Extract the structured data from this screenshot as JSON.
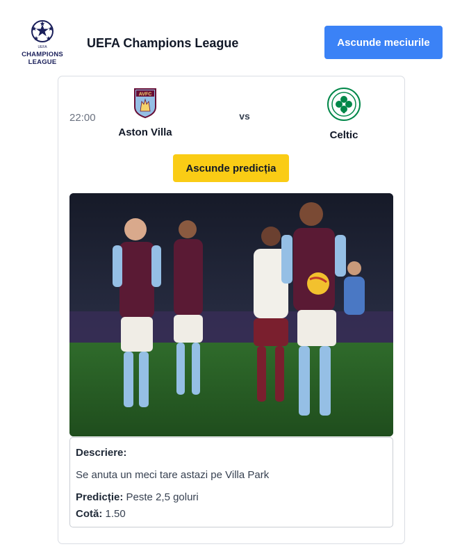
{
  "header": {
    "logo_line1": "CHAMPIONS",
    "logo_line2": "LEAGUE",
    "league_name": "UEFA Champions League",
    "toggle_matches_label": "Ascunde meciurile"
  },
  "match": {
    "time": "22:00",
    "home_team": "Aston Villa",
    "away_team": "Celtic",
    "vs_label": "vs",
    "toggle_prediction_label": "Ascunde predicția"
  },
  "prediction": {
    "description_label": "Descriere:",
    "description_text": "Se anuta un meci tare astazi pe Villa Park",
    "prediction_label": "Predicție:",
    "prediction_value": "Peste 2,5 goluri",
    "odds_label": "Cotă:",
    "odds_value": "1.50"
  },
  "colors": {
    "primary_button": "#3b82f6",
    "prediction_button": "#facc15",
    "villa_claret": "#670e36",
    "villa_blue": "#95bfe5",
    "celtic_green": "#018749"
  },
  "icons": {
    "league_logo": "ucl-starball-logo",
    "home_crest": "aston-villa-crest",
    "away_crest": "celtic-crest"
  }
}
